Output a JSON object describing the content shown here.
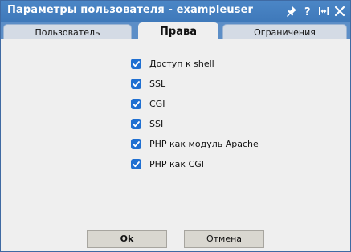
{
  "window": {
    "title": "Параметры пользователя - exampleuser"
  },
  "titlebar_icons": [
    {
      "name": "pin-icon"
    },
    {
      "name": "help-icon"
    },
    {
      "name": "resize-icon"
    },
    {
      "name": "close-icon"
    }
  ],
  "tabs": [
    {
      "label": "Пользователь",
      "active": false
    },
    {
      "label": "Права",
      "active": true
    },
    {
      "label": "Ограничения",
      "active": false
    }
  ],
  "permissions": [
    {
      "label": "Доступ к shell",
      "checked": true
    },
    {
      "label": "SSL",
      "checked": true
    },
    {
      "label": "CGI",
      "checked": true
    },
    {
      "label": "SSI",
      "checked": true
    },
    {
      "label": "PHP как модуль Apache",
      "checked": true
    },
    {
      "label": "PHP как CGI",
      "checked": true
    }
  ],
  "buttons": {
    "ok_label": "Ok",
    "cancel_label": "Отмена"
  },
  "colors": {
    "titlebar": "#4280c0",
    "tabstrip": "#5c8ec7",
    "checkbox": "#1f6fd1",
    "background": "#efefef",
    "button": "#d9d7d0"
  }
}
